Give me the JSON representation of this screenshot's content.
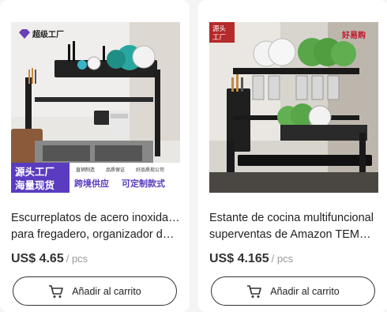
{
  "products": [
    {
      "brand_badge": "超级工厂",
      "banner_line1": "源头工厂",
      "banner_line2": "海量现货",
      "banner_tags": [
        "直销制造",
        "品质保证",
        "好品质现公司"
      ],
      "banner_text_a": "跨境供应",
      "banner_text_b": "可定制款式",
      "title_line1": "Escurreplatos de acero inoxidable",
      "title_line2": "para fregadero, organizador de…",
      "price": "US$ 4.65",
      "unit": "/ pcs",
      "cart_label": "Añadir al carrito",
      "cart_icon": "shopping-cart-icon"
    },
    {
      "corner_label_1": "源头",
      "corner_label_2": "工厂",
      "store_mark": "好易购",
      "title_line1": "Estante de cocina multifuncional",
      "title_line2": "superventas de Amazon TEMU…",
      "price": "US$ 4.165",
      "unit": "/ pcs",
      "cart_label": "Añadir al carrito",
      "cart_icon": "shopping-cart-icon"
    }
  ]
}
